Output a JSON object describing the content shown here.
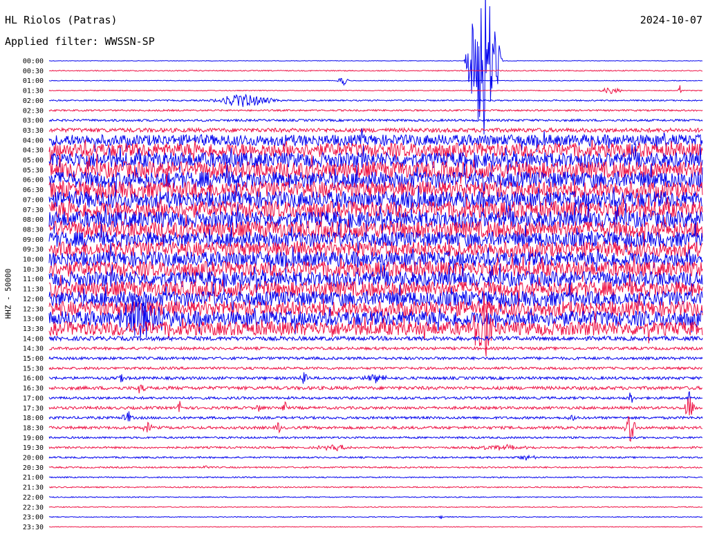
{
  "header": {
    "station": "HL Riolos (Patras)",
    "filter": "Applied filter: WWSSN-SP",
    "date": "2024-10-07"
  },
  "chart_data": {
    "type": "line",
    "ylabel": "HHZ - 50000",
    "colors": [
      "#0000ee",
      "#ee1144"
    ],
    "rows": [
      "00:00",
      "00:30",
      "01:00",
      "01:30",
      "02:00",
      "02:30",
      "03:00",
      "03:30",
      "04:00",
      "04:30",
      "05:00",
      "05:30",
      "06:00",
      "06:30",
      "07:00",
      "07:30",
      "08:00",
      "08:30",
      "09:00",
      "09:30",
      "10:00",
      "10:30",
      "11:00",
      "11:30",
      "12:00",
      "12:30",
      "13:00",
      "13:30",
      "14:00",
      "14:30",
      "15:00",
      "15:30",
      "16:00",
      "16:30",
      "17:00",
      "17:30",
      "18:00",
      "18:30",
      "19:00",
      "19:30",
      "20:00",
      "20:30",
      "21:00",
      "21:30",
      "22:00",
      "22:30",
      "23:00",
      "23:30"
    ],
    "noise_level": [
      0.4,
      0.7,
      0.5,
      0.6,
      1.0,
      1.2,
      1.6,
      3.0,
      8,
      10,
      11,
      12,
      12,
      12,
      12,
      12,
      12,
      12,
      11,
      11,
      11,
      11,
      11,
      11,
      11,
      11,
      11,
      10,
      3.0,
      2.0,
      2.0,
      1.8,
      2.0,
      2.4,
      1.8,
      2.0,
      1.8,
      2.0,
      1.4,
      1.4,
      1.2,
      1.1,
      0.9,
      0.9,
      0.7,
      0.7,
      0.6,
      0.5
    ],
    "events": [
      {
        "row": 0,
        "t": 0.665,
        "amp": 130,
        "dur": 0.03
      },
      {
        "row": 2,
        "t": 0.45,
        "amp": 8,
        "dur": 0.01
      },
      {
        "row": 3,
        "t": 0.86,
        "amp": 6,
        "dur": 0.02
      },
      {
        "row": 3,
        "t": 0.965,
        "amp": 12,
        "dur": 0.003
      },
      {
        "row": 4,
        "t": 0.3,
        "amp": 10,
        "dur": 0.06
      },
      {
        "row": 26,
        "t": 0.14,
        "amp": 32,
        "dur": 0.05
      },
      {
        "row": 27,
        "t": 0.665,
        "amp": 60,
        "dur": 0.02
      },
      {
        "row": 32,
        "t": 0.11,
        "amp": 6,
        "dur": 0.01
      },
      {
        "row": 32,
        "t": 0.39,
        "amp": 10,
        "dur": 0.01
      },
      {
        "row": 32,
        "t": 0.5,
        "amp": 8,
        "dur": 0.02
      },
      {
        "row": 33,
        "t": 0.14,
        "amp": 8,
        "dur": 0.01
      },
      {
        "row": 34,
        "t": 0.89,
        "amp": 12,
        "dur": 0.005
      },
      {
        "row": 34,
        "t": 0.98,
        "amp": 14,
        "dur": 0.005
      },
      {
        "row": 35,
        "t": 0.2,
        "amp": 10,
        "dur": 0.005
      },
      {
        "row": 35,
        "t": 0.32,
        "amp": 10,
        "dur": 0.005
      },
      {
        "row": 35,
        "t": 0.36,
        "amp": 14,
        "dur": 0.005
      },
      {
        "row": 35,
        "t": 0.98,
        "amp": 20,
        "dur": 0.01
      },
      {
        "row": 36,
        "t": 0.12,
        "amp": 12,
        "dur": 0.01
      },
      {
        "row": 36,
        "t": 0.8,
        "amp": 6,
        "dur": 0.01
      },
      {
        "row": 37,
        "t": 0.15,
        "amp": 8,
        "dur": 0.01
      },
      {
        "row": 37,
        "t": 0.35,
        "amp": 12,
        "dur": 0.005
      },
      {
        "row": 37,
        "t": 0.89,
        "amp": 24,
        "dur": 0.01
      },
      {
        "row": 39,
        "t": 0.44,
        "amp": 4,
        "dur": 0.04
      },
      {
        "row": 39,
        "t": 0.69,
        "amp": 4,
        "dur": 0.06
      },
      {
        "row": 40,
        "t": 0.73,
        "amp": 4,
        "dur": 0.02
      },
      {
        "row": 41,
        "t": 0.24,
        "amp": 6,
        "dur": 0.005
      },
      {
        "row": 46,
        "t": 0.6,
        "amp": 4,
        "dur": 0.005
      }
    ]
  }
}
